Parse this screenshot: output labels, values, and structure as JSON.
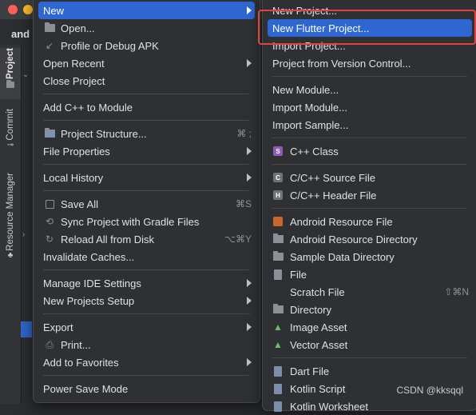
{
  "window": {
    "breadcrumb": "and"
  },
  "sidebar_tabs": [
    {
      "label": "Project",
      "icon": "folder-icon"
    },
    {
      "label": "Commit",
      "icon": "commit-icon"
    },
    {
      "label": "Resource Manager",
      "icon": "resource-manager-icon"
    }
  ],
  "main_menu": {
    "new": "New",
    "open": "Open...",
    "profile_debug": "Profile or Debug APK",
    "open_recent": "Open Recent",
    "close_project": "Close Project",
    "add_cpp": "Add C++ to Module",
    "project_structure": "Project Structure...",
    "project_structure_shortcut": "⌘ ;",
    "file_properties": "File Properties",
    "local_history": "Local History",
    "save_all": "Save All",
    "save_all_shortcut": "⌘S",
    "sync_gradle": "Sync Project with Gradle Files",
    "reload_disk": "Reload All from Disk",
    "reload_disk_shortcut": "⌥⌘Y",
    "invalidate_caches": "Invalidate Caches...",
    "manage_ide": "Manage IDE Settings",
    "new_projects_setup": "New Projects Setup",
    "export": "Export",
    "print": "Print...",
    "add_favorites": "Add to Favorites",
    "power_save": "Power Save Mode"
  },
  "sub_menu": {
    "new_project": "New Project...",
    "new_flutter_project": "New Flutter Project...",
    "import_project": "Import Project...",
    "project_from_vcs": "Project from Version Control...",
    "new_module": "New Module...",
    "import_module": "Import Module...",
    "import_sample": "Import Sample...",
    "cpp_class": "C++ Class",
    "cpp_source": "C/C++ Source File",
    "cpp_header": "C/C++ Header File",
    "android_resource_file": "Android Resource File",
    "android_resource_dir": "Android Resource Directory",
    "sample_data_dir": "Sample Data Directory",
    "file": "File",
    "scratch_file": "Scratch File",
    "scratch_file_shortcut": "⇧⌘N",
    "directory": "Directory",
    "image_asset": "Image Asset",
    "vector_asset": "Vector Asset",
    "dart_file": "Dart File",
    "kotlin_script": "Kotlin Script",
    "kotlin_worksheet": "Kotlin Worksheet"
  },
  "icon_badges": {
    "cpp_class": "S",
    "cpp_source": "C",
    "cpp_header": "H"
  },
  "watermark": "CSDN @kksqql",
  "colors": {
    "highlight": "#2e67d2",
    "annotation_box": "#e0443a",
    "menu_bg": "#2e3033"
  }
}
